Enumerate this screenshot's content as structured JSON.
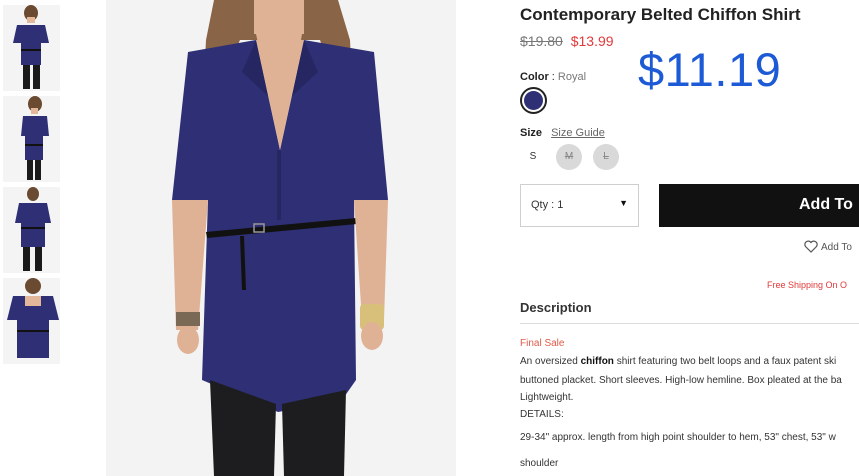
{
  "product": {
    "title": "Contemporary Belted Chiffon Shirt",
    "original_price": "$19.80",
    "sale_price": "$13.99",
    "promo_price": "$11.19"
  },
  "color": {
    "label": "Color",
    "separator": ":",
    "value": "Royal",
    "swatch_hex": "#2e2f74"
  },
  "size": {
    "label": "Size",
    "guide_label": "Size Guide",
    "options": [
      {
        "label": "S",
        "available": true
      },
      {
        "label": "M",
        "available": false
      },
      {
        "label": "L",
        "available": false
      }
    ]
  },
  "quantity": {
    "label": "Qty : 1"
  },
  "add_button": {
    "label": "Add To"
  },
  "wishlist": {
    "label": "Add To"
  },
  "shipping": {
    "text": "Free Shipping On O"
  },
  "description": {
    "heading": "Description",
    "final_sale": "Final Sale",
    "line1_pre": "An oversized ",
    "line1_bold": "chiffon",
    "line1_post": " shirt featuring two belt loops and a faux patent ski",
    "line2": "buttoned placket. Short sleeves. High-low hemline. Box pleated at the ba",
    "line3": "Lightweight.",
    "details_label": "DETAILS:",
    "line4": "29-34\" approx. length from high point shoulder to hem, 53\" chest, 53\" w",
    "line5": "shoulder"
  },
  "colors": {
    "accent_blue": "#1d5ad6",
    "sale_red": "#e03a3a",
    "button_black": "#111111",
    "shirt_navy": "#2e2f74"
  }
}
